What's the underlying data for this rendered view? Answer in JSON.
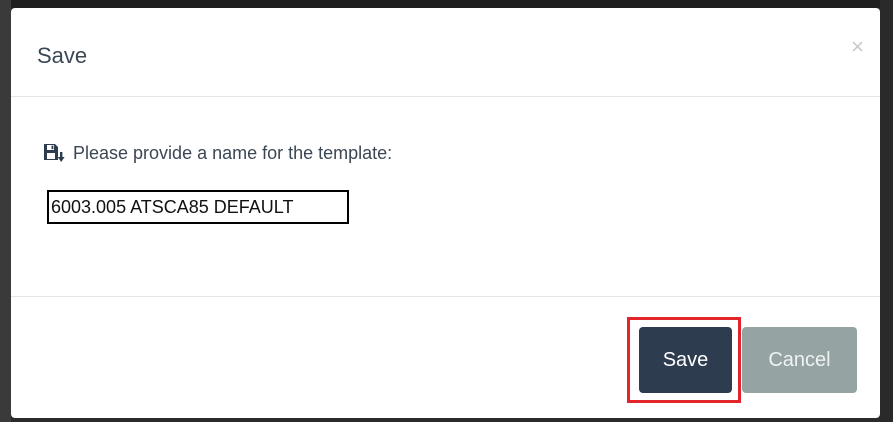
{
  "dialog": {
    "title": "Save",
    "close_glyph": "×",
    "prompt_icon": "floppy-disk-download-icon",
    "prompt": "Please provide a name for the template:",
    "name_input_value": "6003.005 ATSCA85 DEFAULT"
  },
  "footer": {
    "save_label": "Save",
    "cancel_label": "Cancel"
  },
  "colors": {
    "primary": "#2d3d4f",
    "secondary": "#95a3a3",
    "highlight": "#e3242b"
  }
}
